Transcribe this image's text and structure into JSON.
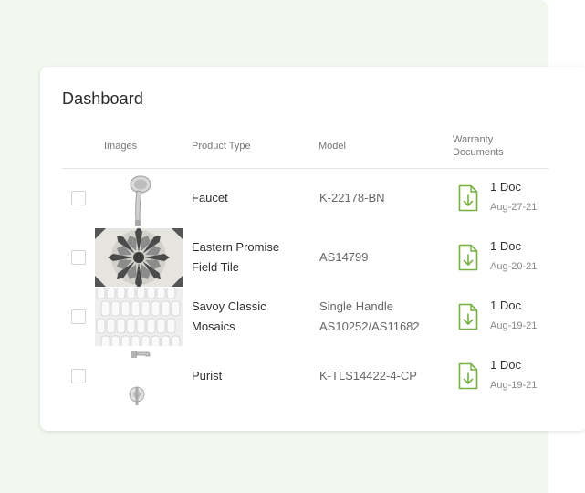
{
  "dashboard": {
    "title": "Dashboard"
  },
  "table": {
    "columns": {
      "images": "Images",
      "product_type": "Product Type",
      "model": "Model",
      "warranty_line1": "Warranty",
      "warranty_line2": "Documents"
    },
    "rows": [
      {
        "product_line1": "Faucet",
        "product_line2": "",
        "model_line1": "K-22178-BN",
        "model_line2": "",
        "docs": "1 Doc",
        "date": "Aug-27-21",
        "image": "shower-head-image"
      },
      {
        "product_line1": "Eastern Promise",
        "product_line2": "Field Tile",
        "model_line1": "AS14799",
        "model_line2": "",
        "docs": "1 Doc",
        "date": "Aug-20-21",
        "image": "patterned-tile-image"
      },
      {
        "product_line1": "Savoy Classic",
        "product_line2": "Mosaics",
        "model_line1": "Single Handle",
        "model_line2": "AS10252/AS11682",
        "docs": "1 Doc",
        "date": "Aug-19-21",
        "image": "mosaic-tile-image"
      },
      {
        "product_line1": "Purist",
        "product_line2": "",
        "model_line1": "K-TLS14422-4-CP",
        "model_line2": "",
        "docs": "1 Doc",
        "date": "Aug-19-21",
        "image": "tub-spout-image"
      }
    ]
  },
  "colors": {
    "accent_green": "#76b043",
    "background_tint": "#f3f8ee"
  }
}
